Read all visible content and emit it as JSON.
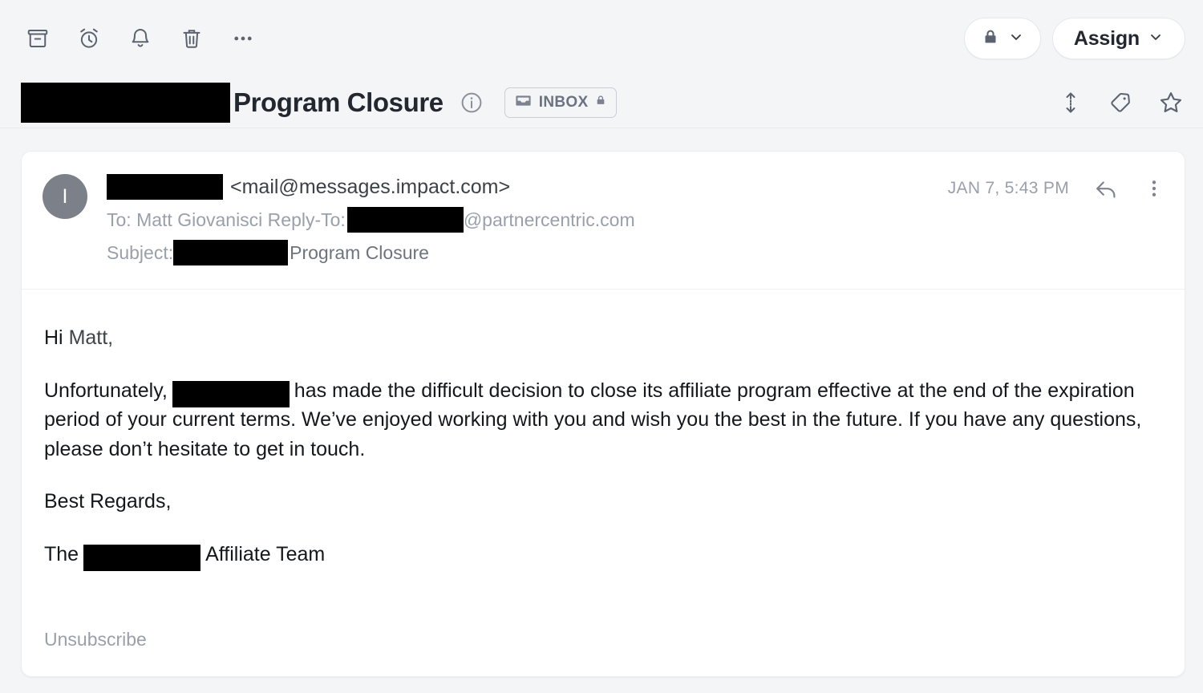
{
  "toolbar": {
    "actions": [
      {
        "name": "archive-icon",
        "label": "Archive"
      },
      {
        "name": "snooze-icon",
        "label": "Snooze"
      },
      {
        "name": "remind-icon",
        "label": "Remind"
      },
      {
        "name": "trash-icon",
        "label": "Delete"
      },
      {
        "name": "more-icon",
        "label": "More"
      }
    ],
    "lock_button": {
      "icon": "lock-icon",
      "chevron": "chevron-down-icon"
    },
    "assign_button": {
      "label": "Assign",
      "chevron": "chevron-down-icon"
    }
  },
  "subject_header": {
    "redacted_prefix": "",
    "title": "Program Closure",
    "info_icon": "info-circle-icon",
    "folder_badge": {
      "label": "INBOX",
      "icon": "inbox-tray-icon",
      "lock": "lock-icon"
    },
    "right_icons": [
      {
        "name": "expand-collapse-icon"
      },
      {
        "name": "tag-icon"
      },
      {
        "name": "star-icon"
      }
    ]
  },
  "message": {
    "avatar_initial": "I",
    "sender_redacted": "",
    "sender_email": "<mail@messages.impact.com>",
    "to_prefix": "To: Matt Giovanisci Reply-To:",
    "reply_to_domain": "@partnercentric.com",
    "subject_prefix": "Subject:",
    "subject_text": "Program Closure",
    "timestamp": "JAN 7, 5:43 PM",
    "reply_icon": "reply-arrow-icon",
    "more_icon": "more-vertical-icon",
    "body": {
      "greeting_hi": "Hi ",
      "greeting_name": "Matt,",
      "para_start": "Unfortunately,",
      "para_rest": "has made the difficult decision to close its affiliate program effective at the end of the expiration period of your current terms.  We’ve enjoyed working with you and wish you the best in the future.  If you have any questions, please don’t hesitate to get in touch.",
      "closing": "Best Regards,",
      "sig_start": "The",
      "sig_end": "Affiliate Team"
    },
    "unsubscribe": "Unsubscribe"
  },
  "colors": {
    "page_background": "#f4f5f7",
    "card_background": "#ffffff",
    "text_primary": "#14171c",
    "text_muted": "#9aa0aa",
    "icon": "#5c6370",
    "avatar": "#7c8189",
    "redaction": "#000000"
  }
}
